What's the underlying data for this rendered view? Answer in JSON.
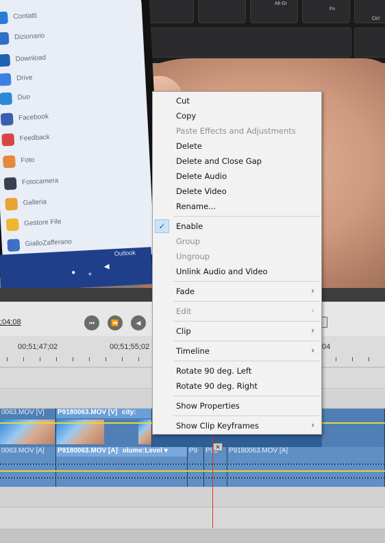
{
  "video_frame": {
    "phone_apps": [
      "Contatti",
      "Dizionario",
      "Download",
      "Drive",
      "Duo",
      "Facebook",
      "Feedback",
      "Foto",
      "Fotocamera",
      "Galleria",
      "Gestore File",
      "GialloZafferano"
    ],
    "phone_taskbar_label": "Outlook",
    "keyboard_keys": [
      "Alt Gr",
      "Fn",
      "Ctrl"
    ]
  },
  "editor": {
    "timecode": ";04;08",
    "ruler_labels": [
      "00;51;47;02",
      "00;51;55;02",
      "04"
    ],
    "video_track": {
      "clip_left_label": "0063.MOV [V]",
      "clip_main_label": "P9180063.MOV [V]",
      "clip_effect_label": "city:"
    },
    "audio_track": {
      "clip_left_label": "0063.MOV [A]",
      "clip_main_label": "P9180063.MOV [A]",
      "clip_effect_label": "olume:Level",
      "clip_small_1": "P9",
      "clip_small_2": "P91",
      "clip_right_label": "P9180063.MOV [A]"
    },
    "close_glyph": "✕"
  },
  "context_menu": {
    "items": [
      {
        "label": "Cut",
        "enabled": true
      },
      {
        "label": "Copy",
        "enabled": true
      },
      {
        "label": "Paste Effects and Adjustments",
        "enabled": false
      },
      {
        "label": "Delete",
        "enabled": true
      },
      {
        "label": "Delete and Close Gap",
        "enabled": true
      },
      {
        "label": "Delete Audio",
        "enabled": true
      },
      {
        "label": "Delete Video",
        "enabled": true
      },
      {
        "label": "Rename...",
        "enabled": true
      },
      {
        "label": "Enable",
        "enabled": true,
        "checked": true
      },
      {
        "label": "Group",
        "enabled": false
      },
      {
        "label": "Ungroup",
        "enabled": false
      },
      {
        "label": "Unlink Audio and Video",
        "enabled": true
      },
      {
        "label": "Fade",
        "enabled": true,
        "submenu": true
      },
      {
        "label": "Edit",
        "enabled": false,
        "submenu": true
      },
      {
        "label": "Clip",
        "enabled": true,
        "submenu": true
      },
      {
        "label": "Timeline",
        "enabled": true,
        "submenu": true
      },
      {
        "label": "Rotate 90 deg. Left",
        "enabled": true
      },
      {
        "label": "Rotate 90 deg. Right",
        "enabled": true
      },
      {
        "label": "Show Properties",
        "enabled": true
      },
      {
        "label": "Show Clip Keyframes",
        "enabled": true,
        "submenu": true
      }
    ],
    "check_glyph": "✓",
    "submenu_glyph": "›"
  },
  "colors": {
    "menu_bg": "#f2f2f2",
    "disabled_text": "#8d8d8d",
    "check_highlight": "#cce4f7",
    "track_blue": "#3a6aa0",
    "playhead": "#e0312b"
  }
}
